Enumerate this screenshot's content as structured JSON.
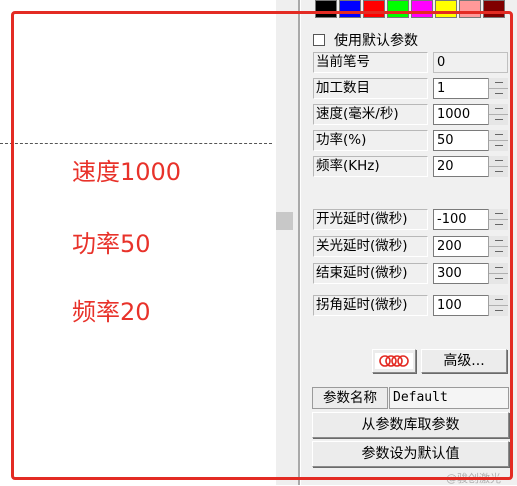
{
  "canvas": {
    "notes": [
      "速度1000",
      "功率50",
      "频率20"
    ]
  },
  "palette": {
    "colors": [
      "#000000",
      "#0000ff",
      "#ff0000",
      "#00ff00",
      "#ff00ff",
      "#ffff00",
      "#ff9999",
      "#800000"
    ]
  },
  "params": {
    "use_default_label": "使用默认参数",
    "rows": [
      {
        "label": "当前笔号",
        "value": "0"
      },
      {
        "label": "加工数目",
        "value": "1"
      },
      {
        "label": "速度(毫米/秒)",
        "value": "1000"
      },
      {
        "label": "功率(%)",
        "value": "50"
      },
      {
        "label": "频率(KHz)",
        "value": "20"
      },
      {
        "label": "开光延时(微秒)",
        "value": "-100"
      },
      {
        "label": "关光延时(微秒)",
        "value": "200"
      },
      {
        "label": "结束延时(微秒)",
        "value": "300"
      },
      {
        "label": "拐角延时(微秒)",
        "value": "100"
      }
    ],
    "advanced_button": "高级...",
    "param_name_label": "参数名称",
    "param_name_value": "Default",
    "load_button": "从参数库取参数",
    "set_default_button": "参数设为默认值"
  },
  "watermark": "@骏创激光"
}
